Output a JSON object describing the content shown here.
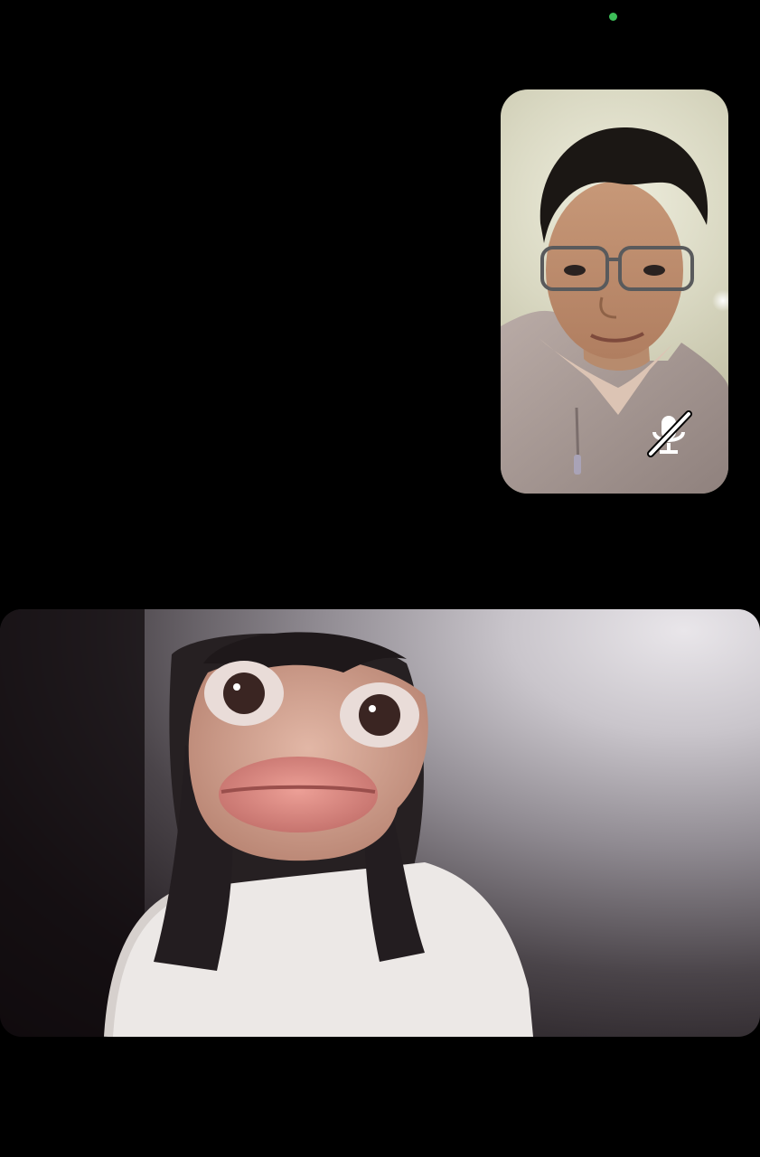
{
  "status": {
    "camera_indicator_color": "#3dbe58"
  },
  "pip_video": {
    "participant": "remote-man-with-glasses",
    "mic_status": "muted",
    "mute_icon": "mic-slash-icon"
  },
  "main_video": {
    "participant": "woman-with-face-filter"
  }
}
